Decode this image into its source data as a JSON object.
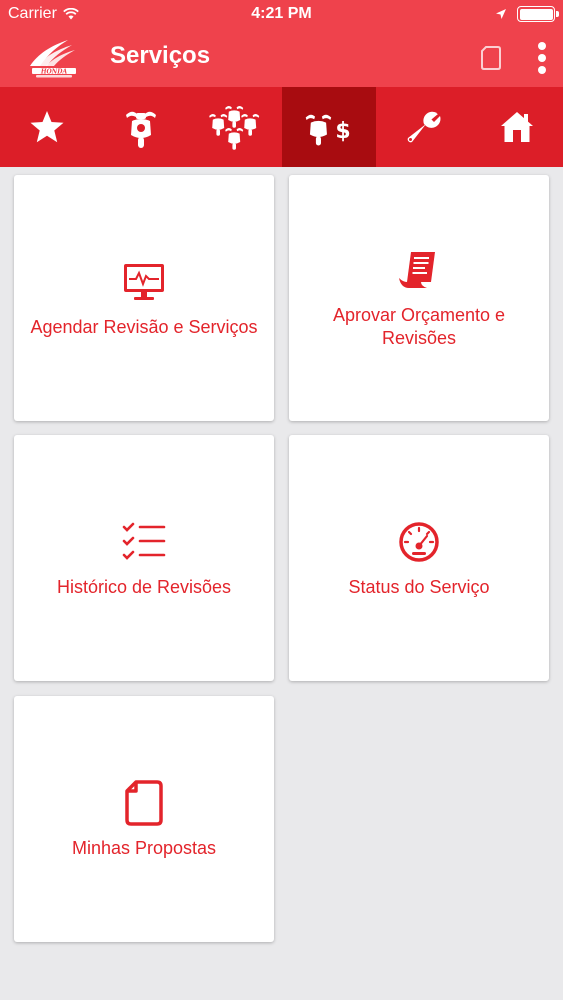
{
  "status_bar": {
    "carrier": "Carrier",
    "time": "4:21 PM"
  },
  "navbar": {
    "title": "Serviços",
    "logo_text": "HONDA"
  },
  "tabs": [
    {
      "name": "favorites",
      "icon": "star-icon",
      "active": false
    },
    {
      "name": "motorcycle",
      "icon": "motorcycle-icon",
      "active": false
    },
    {
      "name": "motorcycles-group",
      "icon": "motorcycle-group-icon",
      "active": false
    },
    {
      "name": "services-cost",
      "icon": "motorcycle-dollar-icon",
      "active": true
    },
    {
      "name": "tools",
      "icon": "wrench-icon",
      "active": false
    },
    {
      "name": "home",
      "icon": "home-icon",
      "active": false
    }
  ],
  "cards": [
    {
      "label": "Agendar Revisão e Serviços",
      "icon": "monitor-icon"
    },
    {
      "label": "Aprovar Orçamento e Revisões",
      "icon": "receipt-icon"
    },
    {
      "label": "Histórico de Revisões",
      "icon": "checklist-icon"
    },
    {
      "label": "Status do Serviço",
      "icon": "speedometer-icon"
    },
    {
      "label": "Minhas Propostas",
      "icon": "document-icon"
    }
  ],
  "colors": {
    "header": "#ef424c",
    "tabbar": "#dc1e28",
    "tab_active": "#a80c10",
    "accent": "#e3242b",
    "background": "#e9e9eb"
  }
}
